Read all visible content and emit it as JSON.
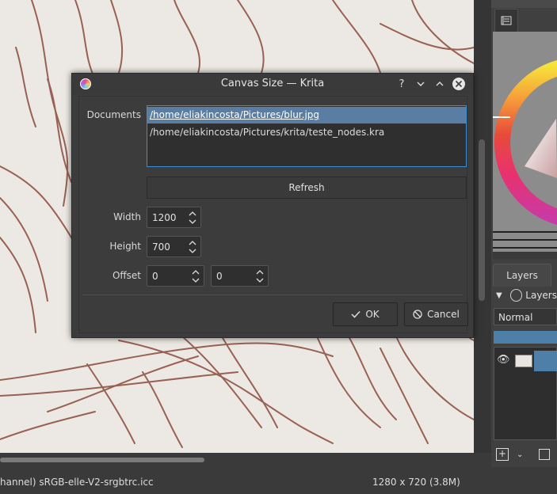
{
  "dialog": {
    "title": "Canvas Size — Krita",
    "help_glyph": "?",
    "documents_label": "Documents",
    "documents": [
      "/home/eliakincosta/Pictures/blur.jpg",
      "/home/eliakincosta/Pictures/krita/teste_nodes.kra"
    ],
    "refresh_label": "Refresh",
    "width_label": "Width",
    "width_value": "1200",
    "height_label": "Height",
    "height_value": "700",
    "offset_label": "Offset",
    "offset_x": "0",
    "offset_y": "0",
    "ok_label": "OK",
    "cancel_label": "Cancel"
  },
  "layers": {
    "tab_label": "Layers",
    "header_label": "Layers",
    "blend_mode": "Normal"
  },
  "status": {
    "left": "hannel)  sRGB-elle-V2-srgbtrc.icc",
    "right": "1280 x 720 (3.8M)"
  },
  "colors": {
    "accent": "#3d8fd4",
    "selection": "#5a7ea3",
    "opacity_bar": "#4e7fa8"
  }
}
